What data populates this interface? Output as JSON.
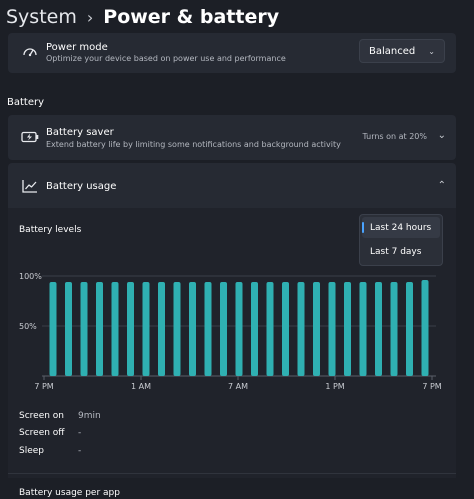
{
  "header": {
    "breadcrumb_root": "System",
    "separator": "›",
    "current": "Power & battery"
  },
  "power_mode": {
    "icon": "power-mode-icon",
    "title": "Power mode",
    "subtitle": "Optimize your device based on power use and performance",
    "selected": "Balanced",
    "chevron": "⌄"
  },
  "battery_section": {
    "label": "Battery"
  },
  "battery_saver": {
    "icon": "battery-saver-icon",
    "title": "Battery saver",
    "subtitle": "Extend battery life by limiting some notifications and background activity",
    "status": "Turns on at 20%",
    "chevron": "⌄"
  },
  "battery_usage": {
    "icon": "chart-line-icon",
    "title": "Battery usage",
    "chevron": "⌃"
  },
  "range_menu": {
    "options": [
      "Last 24 hours",
      "Last 7 days"
    ],
    "selected_index": 0
  },
  "chart_data": {
    "type": "bar",
    "title": "Battery levels",
    "y_ticks": [
      "100%",
      "50%"
    ],
    "x_ticks": [
      "7 PM",
      "1 AM",
      "7 AM",
      "1 PM",
      "7 PM"
    ],
    "ylim": [
      0,
      100
    ],
    "values": [
      94,
      94,
      94,
      94,
      94,
      94,
      94,
      94,
      94,
      94,
      94,
      94,
      94,
      94,
      94,
      94,
      94,
      94,
      94,
      94,
      94,
      94,
      94,
      94,
      96
    ],
    "bar_color": "#2fb0b2",
    "grid": true
  },
  "stats": [
    {
      "label": "Screen on",
      "value": "9min"
    },
    {
      "label": "Screen off",
      "value": "-"
    },
    {
      "label": "Sleep",
      "value": "-"
    }
  ],
  "per_app": {
    "title": "Battery usage per app"
  }
}
